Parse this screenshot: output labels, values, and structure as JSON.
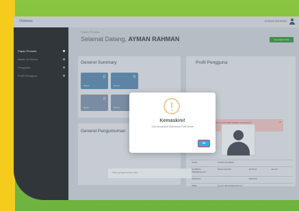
{
  "topbar": {
    "brand": "Vitalisasi",
    "user_name": "AYMAN RAHMAN"
  },
  "sidebar": {
    "items": [
      {
        "label": "Papan Pemuka",
        "active": true
      },
      {
        "label": "Bahan Di Rekod",
        "active": false
      },
      {
        "label": "Pengguna",
        "active": false
      },
      {
        "label": "Profil Pengguna",
        "active": false
      }
    ]
  },
  "main": {
    "breadcrumb": "Papan Pemuka",
    "welcome_prefix": "Selamat Datang, ",
    "welcome_name": "AYMAN RAHMAN",
    "action_button": "Kemaskini Profil",
    "summary_title": "Generel Summary",
    "profile_title": "Profil Pengguna",
    "announcement_title": "Generel Pengumuman",
    "announcement_placeholder": "Tiada pengumuman baru",
    "stats": [
      {
        "number": "0",
        "label": "Bahan"
      },
      {
        "number": "0",
        "label": "Rekod"
      },
      {
        "number": "0",
        "label": "Bahan"
      },
      {
        "number": "0",
        "label": "Rekod"
      }
    ],
    "alert_text": "Sila lengkapkan maklumat profil anda sebelum meneruskan",
    "alert_close": "×",
    "info_rows": [
      {
        "key": "NAMA",
        "value": "AYMAN RAHMAN",
        "key2": "",
        "value2": ""
      },
      {
        "key": "NOMBOR PENGENALAN",
        "value": "920101012345",
        "key2": "JANTINA",
        "value2": "LELAKI"
      },
      {
        "key": "JAWATAN",
        "value": "",
        "key2": "JABATAN",
        "value2": ""
      },
      {
        "key": "EMEL",
        "value": "ayman.rahman@gmail.com",
        "key2": "",
        "value2": ""
      }
    ]
  },
  "modal": {
    "title": "Kemaskini!",
    "message": "Sila kemaskini Maklumat Profil Anda",
    "ok_label": "Ok"
  },
  "colors": {
    "frame_green": "#8cc63f",
    "frame_yellow": "#f5cb1e",
    "sidebar_bg": "#2c3035",
    "ok_button": "#3ea9df",
    "ok_highlight": "#e6324c",
    "warning_icon": "#f3c89b"
  }
}
